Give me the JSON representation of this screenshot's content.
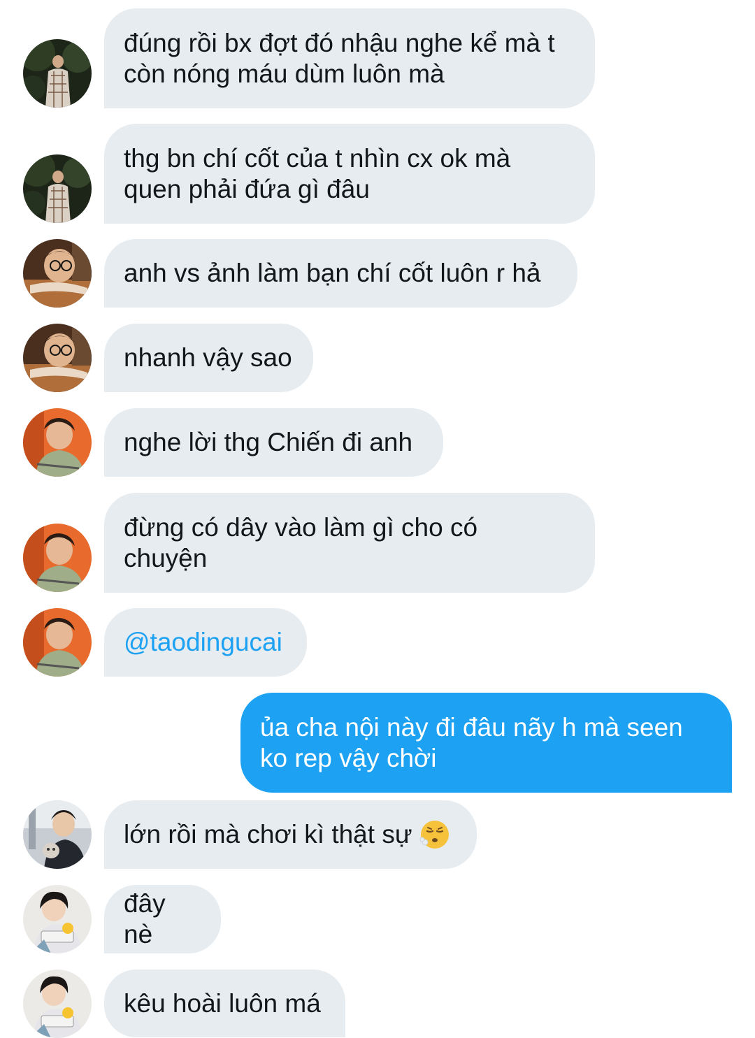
{
  "conversation": {
    "messages": [
      {
        "text": "đúng rồi bx đợt đó nhậu nghe kể mà t\ncòn nóng máu dùm luôn mà"
      },
      {
        "text": "thg bn chí cốt của t nhìn cx ok mà\nquen phải đứa gì đâu"
      },
      {
        "text": "anh vs ảnh làm bạn chí cốt luôn r hả"
      },
      {
        "text": "nhanh vậy sao"
      },
      {
        "text": "nghe lời thg Chiến đi anh"
      },
      {
        "text": "đừng có dây vào làm gì cho có\nchuyện"
      },
      {
        "text": "@taodingucai"
      },
      {
        "text": "ủa cha nội này đi đâu nãy h mà seen\nko rep vậy chời"
      },
      {
        "text": "lớn rồi mà chơi kì thật sự",
        "emoji": "face-exhaling-emoji"
      },
      {
        "text": "đây nè"
      },
      {
        "text": "kêu hoài luôn má"
      }
    ]
  },
  "colors": {
    "incoming_bubble": "#e6ecf0",
    "outgoing_bubble": "#1da1f2",
    "mention": "#1da1f2",
    "text": "#14171a"
  }
}
